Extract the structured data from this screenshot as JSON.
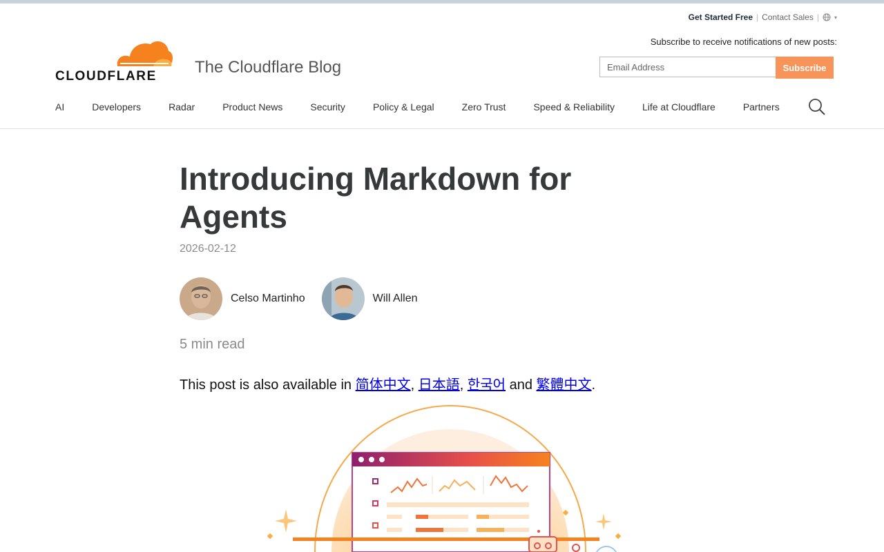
{
  "utility": {
    "get_started": "Get Started Free",
    "contact_sales": "Contact Sales",
    "separator": "|"
  },
  "brand": {
    "logo_text": "CLOUDFLARE",
    "blog_title": "The Cloudflare Blog",
    "accent_color": "#f6821f"
  },
  "subscribe": {
    "label": "Subscribe to receive notifications of new posts:",
    "placeholder": "Email Address",
    "button": "Subscribe",
    "button_color": "#f6945a"
  },
  "nav": {
    "items": [
      {
        "label": "AI"
      },
      {
        "label": "Developers"
      },
      {
        "label": "Radar"
      },
      {
        "label": "Product News"
      },
      {
        "label": "Security"
      },
      {
        "label": "Policy & Legal"
      },
      {
        "label": "Zero Trust"
      },
      {
        "label": "Speed & Reliability"
      },
      {
        "label": "Life at Cloudflare"
      },
      {
        "label": "Partners"
      }
    ],
    "search_icon": "search-icon"
  },
  "article": {
    "title": "Introducing Markdown for Agents",
    "date": "2026-02-12",
    "authors": [
      {
        "name": "Celso Martinho"
      },
      {
        "name": "Will Allen"
      }
    ],
    "read_time": "5 min read",
    "translations": {
      "prefix": "This post is also available in",
      "links": [
        "简体中文",
        "日本語",
        "한국어",
        "繁體中文"
      ],
      "comma": ",",
      "and": "and",
      "period": "."
    }
  }
}
